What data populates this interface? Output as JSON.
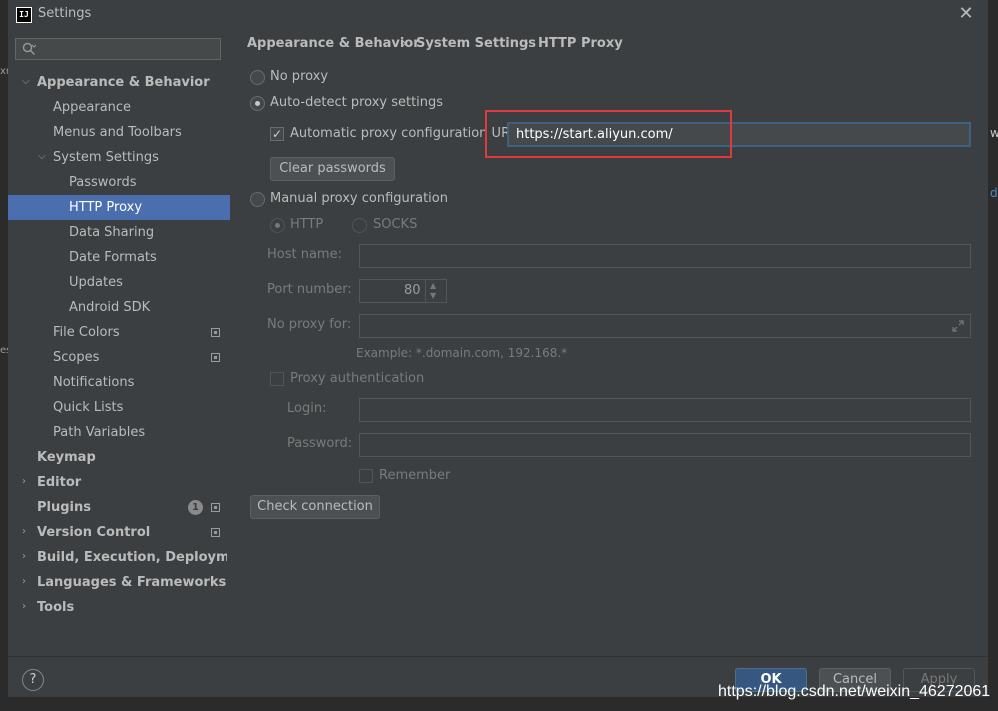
{
  "window": {
    "title": "Settings",
    "app_icon": "IJ"
  },
  "search": {
    "placeholder": ""
  },
  "sidebar": {
    "items": [
      {
        "label": "Appearance & Behavior"
      },
      {
        "label": "Appearance"
      },
      {
        "label": "Menus and Toolbars"
      },
      {
        "label": "System Settings"
      },
      {
        "label": "Passwords"
      },
      {
        "label": "HTTP Proxy"
      },
      {
        "label": "Data Sharing"
      },
      {
        "label": "Date Formats"
      },
      {
        "label": "Updates"
      },
      {
        "label": "Android SDK"
      },
      {
        "label": "File Colors"
      },
      {
        "label": "Scopes"
      },
      {
        "label": "Notifications"
      },
      {
        "label": "Quick Lists"
      },
      {
        "label": "Path Variables"
      },
      {
        "label": "Keymap"
      },
      {
        "label": "Editor"
      },
      {
        "label": "Plugins"
      },
      {
        "label": "Version Control"
      },
      {
        "label": "Build, Execution, Deployment"
      },
      {
        "label": "Languages & Frameworks"
      },
      {
        "label": "Tools"
      }
    ],
    "plugins_badge": "1"
  },
  "breadcrumb": [
    "Appearance & Behavior",
    "System Settings",
    "HTTP Proxy"
  ],
  "proxy": {
    "no_proxy": "No proxy",
    "auto_detect": "Auto-detect proxy settings",
    "auto_url_label": "Automatic proxy configuration URL:",
    "auto_url_value": "https://start.aliyun.com/",
    "clear_passwords": "Clear passwords",
    "manual": "Manual proxy configuration",
    "http": "HTTP",
    "socks": "SOCKS",
    "host_label": "Host name:",
    "port_label": "Port number:",
    "port_value": "80",
    "no_proxy_for_label": "No proxy for:",
    "example": "Example: *.domain.com, 192.168.*",
    "proxy_auth": "Proxy authentication",
    "login_label": "Login:",
    "password_label": "Password:",
    "remember": "Remember",
    "check_connection": "Check connection"
  },
  "footer": {
    "help": "?",
    "ok": "OK",
    "cancel": "Cancel",
    "apply": "Apply",
    "watermark": "https://blog.csdn.net/weixin_46272061"
  },
  "edge": {
    "left1": "xr",
    "left2": "es",
    "right1": "w",
    "right2": "de"
  }
}
